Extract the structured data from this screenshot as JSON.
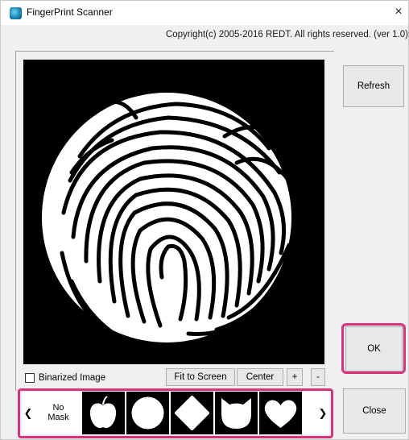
{
  "window": {
    "title": "FingerPrint Scanner",
    "close_glyph": "×",
    "copyright": "Copyright(c) 2005-2016 REDT. All rights reserved.  (ver 1.0)",
    "icon": "fingerprint-app-icon"
  },
  "buttons": {
    "refresh": "Refresh",
    "ok": "OK",
    "close": "Close",
    "fit_to_screen": "Fit to Screen",
    "center": "Center",
    "zoom_in": "+",
    "zoom_out": "-"
  },
  "options": {
    "binarized_label": "Binarized Image",
    "binarized_checked": false
  },
  "mask_strip": {
    "scroll_left": "❮",
    "scroll_right": "❯",
    "no_mask_line1": "No",
    "no_mask_line2": "Mask",
    "masks": [
      "apple",
      "circle",
      "diamond",
      "cat",
      "heart"
    ]
  },
  "colors": {
    "highlight": "#d6337c",
    "viewer_background": "#000000"
  }
}
